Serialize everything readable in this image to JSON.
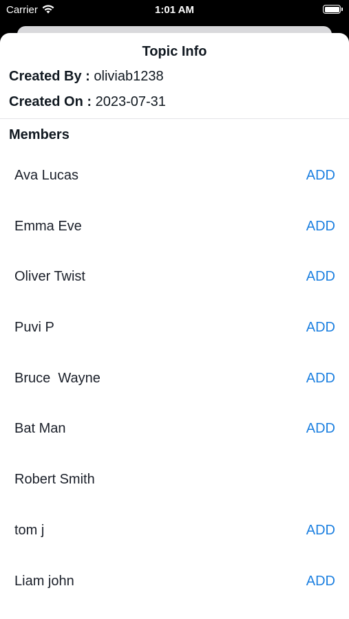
{
  "status_bar": {
    "carrier": "Carrier",
    "time": "1:01 AM"
  },
  "sheet": {
    "title": "Topic Info",
    "created_by_label": "Created By :",
    "created_by_value": "oliviab1238",
    "created_on_label": "Created On :",
    "created_on_value": "2023-07-31",
    "members_heading": "Members"
  },
  "members": [
    {
      "name": "Ava Lucas",
      "action": "ADD"
    },
    {
      "name": "Emma Eve",
      "action": "ADD"
    },
    {
      "name": "Oliver Twist",
      "action": "ADD"
    },
    {
      "name": "Puvi P",
      "action": "ADD"
    },
    {
      "name": "Bruce  Wayne",
      "action": "ADD"
    },
    {
      "name": "Bat Man",
      "action": "ADD"
    },
    {
      "name": "Robert Smith",
      "action": ""
    },
    {
      "name": "tom j",
      "action": "ADD"
    },
    {
      "name": "Liam john",
      "action": "ADD"
    }
  ],
  "colors": {
    "accent": "#1b7fe0",
    "text": "#101820"
  }
}
